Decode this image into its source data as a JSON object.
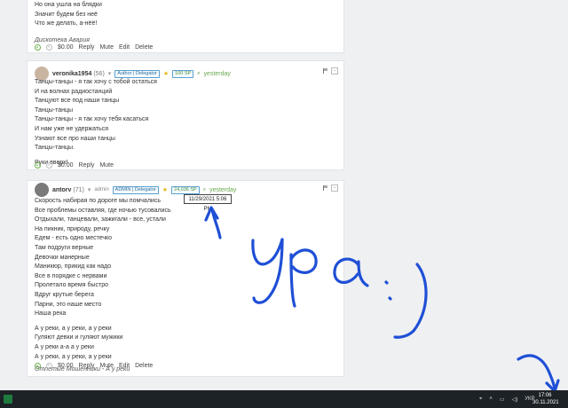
{
  "post1": {
    "lines": [
      "Но она ушла на блядки",
      "Значит будем без неё",
      "Что же делать, а-нёё!"
    ],
    "signature": "Дискотека Авария",
    "score": "$0.00",
    "actions": [
      "Reply",
      "Mute",
      "Edit",
      "Delete"
    ]
  },
  "post2": {
    "username": "veronika1954",
    "rep": "(56)",
    "badge": "Author | Delegator",
    "sp": "100 SP",
    "time": "yesterday",
    "lines": [
      "Танцы-танцы - я так хочу с тобой остаться",
      "И на волнах радиостанций",
      "Танцуют все под наши танцы",
      "Танцы-танцы",
      "Танцы-танцы - я так хочу тебя касаться",
      "И нам уже не удержаться",
      "Узнают все про наши танцы",
      "Танцы-танцы."
    ],
    "extra": "Руки вверх!",
    "score": "$0.00",
    "actions": [
      "Reply",
      "Mute"
    ]
  },
  "post3": {
    "username": "antorv",
    "rep": "(71)",
    "role": "admin",
    "badge": "ADMIN | Delegator",
    "sp": "24,036 SP",
    "time": "yesterday",
    "tooltip": "11/29/2021 5:06 PM",
    "lines": [
      "Скорость набирая по дороге мы помчались",
      "Все проблемы оставляя, где ночью тусовались",
      "Отдыхали, танцевали, зажигали - все, устали",
      "На пикник, природу, речку",
      "Едем - есть одно местечко",
      "Там подруги верные",
      "Девочки манерные",
      "Маникюр, прикид как надо",
      "Все в порядке с нервами",
      "Пролетало время быстро",
      "Вдруг крутые берега",
      "Парни, это наше место",
      "Наша река"
    ],
    "lines2": [
      "А у реки, а у реки, а у реки",
      "Гуляют девки и гуляют мужики",
      "А у реки а-а а у реки",
      "А у реки, а у реки, а у реки"
    ],
    "signature": "Отпетые Мошенники - А у реки",
    "score": "$0.00",
    "actions": [
      "Reply",
      "Mute",
      "Edit",
      "Delete"
    ]
  },
  "taskbar": {
    "language": "УКР",
    "time": "17:06",
    "date": "30.11.2021"
  },
  "icons": [
    "excel-icon",
    "notification-icon",
    "chevron-up-icon",
    "network-icon",
    "volume-icon",
    "flag-icon",
    "search-icon"
  ]
}
